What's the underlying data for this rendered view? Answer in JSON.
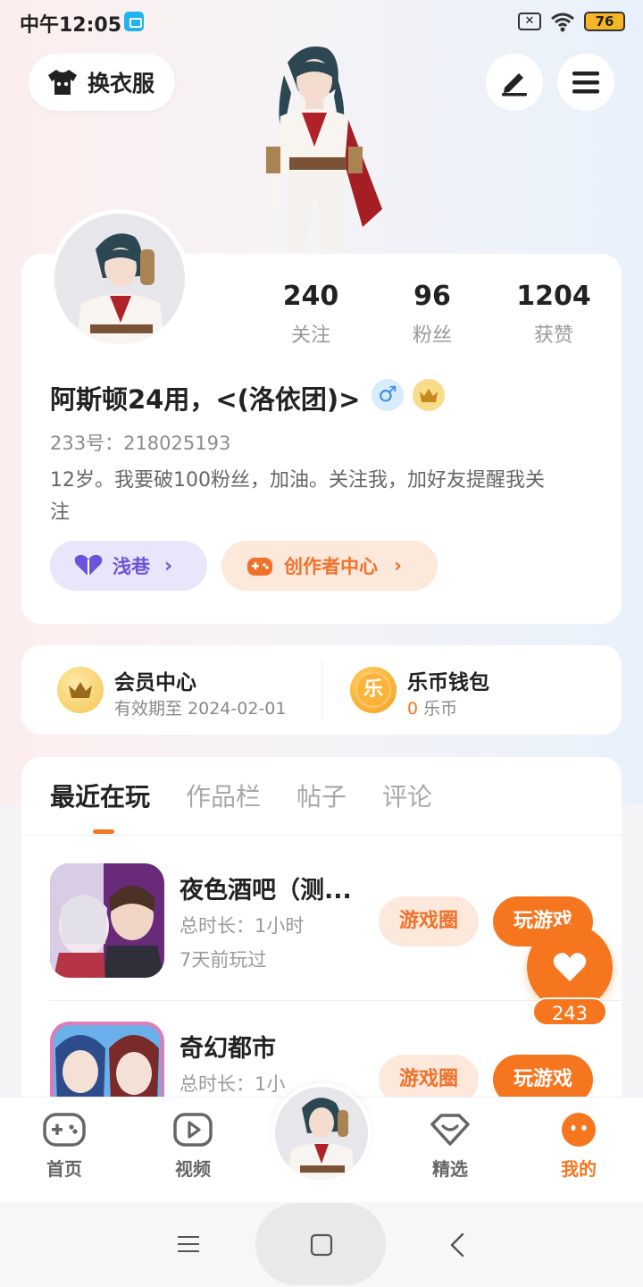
{
  "status_bar": {
    "time": "中午12:05",
    "battery": "76"
  },
  "header": {
    "outfit_label": "换衣服",
    "edit_icon": "pen-icon",
    "menu_icon": "menu-icon"
  },
  "profile": {
    "stats": [
      {
        "value": "240",
        "label": "关注"
      },
      {
        "value": "96",
        "label": "粉丝"
      },
      {
        "value": "1204",
        "label": "获赞"
      }
    ],
    "username": "阿斯顿24用，<(洛依团)>",
    "gender_symbol": "♂",
    "uid": "233号：218025193",
    "bio": "12岁。我要破100粉丝，加油。关注我，加好友提醒我关注注",
    "bio_line1": "12岁。我要破100粉丝，加油。关注我，加好友提醒我关",
    "bio_line2": "注",
    "qianxiang_label": "浅巷",
    "creator_label": "创作者中心"
  },
  "member": {
    "vip_title": "会员中心",
    "vip_sub": "有效期至 2024-02-01",
    "wallet_title": "乐币钱包",
    "wallet_coin_glyph": "乐",
    "wallet_amount": "0",
    "wallet_unit": "乐币"
  },
  "tabs": [
    "最近在玩",
    "作品栏",
    "帖子",
    "评论"
  ],
  "games": [
    {
      "name": "夜色酒吧（测...",
      "duration": "总时长：1小时",
      "last_played": "7天前玩过",
      "circle_label": "游戏圈",
      "play_label": "玩游戏"
    },
    {
      "name": "奇幻都市",
      "duration": "总时长：1小",
      "circle_label": "游戏圈",
      "play_label": "玩游戏"
    }
  ],
  "float_like": {
    "count": "243"
  },
  "bottom_nav": [
    {
      "label": "首页",
      "icon": "gamepad-icon"
    },
    {
      "label": "视频",
      "icon": "video-icon"
    },
    {
      "label": "精选",
      "icon": "heart-diamond-icon"
    },
    {
      "label": "我的",
      "icon": "face-icon"
    }
  ],
  "colors": {
    "accent": "#f5761e",
    "purple": "#6b54d9"
  }
}
